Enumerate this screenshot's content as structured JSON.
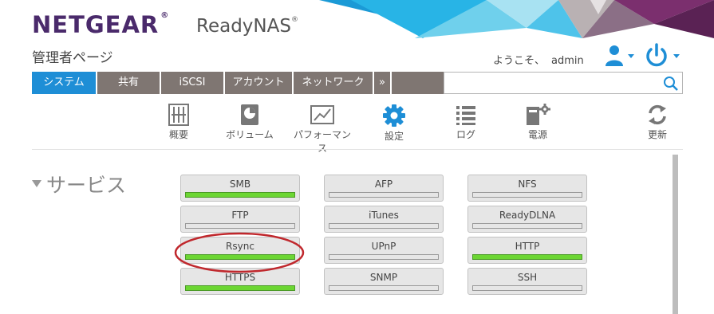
{
  "header": {
    "brand": "NETGEAR",
    "brand_mark": "®",
    "product": "ReadyNAS",
    "product_mark": "®",
    "page_title": "管理者ページ",
    "welcome_text": "ようこそ、",
    "username": "admin"
  },
  "nav": {
    "tabs": [
      {
        "label": "システム",
        "active": true
      },
      {
        "label": "共有",
        "active": false
      },
      {
        "label": "iSCSI",
        "active": false
      },
      {
        "label": "アカウント",
        "active": false
      },
      {
        "label": "ネットワーク",
        "active": false
      },
      {
        "label": "»",
        "active": false
      }
    ],
    "search_value": ""
  },
  "subnav": {
    "items": [
      {
        "label": "概要",
        "icon": "overview-icon"
      },
      {
        "label": "ボリューム",
        "icon": "volume-icon"
      },
      {
        "label": "パフォーマンス",
        "icon": "performance-icon"
      },
      {
        "label": "設定",
        "icon": "settings-gear-icon",
        "active": true
      },
      {
        "label": "ログ",
        "icon": "log-list-icon"
      },
      {
        "label": "電源",
        "icon": "power-device-icon"
      },
      {
        "label": "更新",
        "icon": "refresh-icon"
      }
    ]
  },
  "services": {
    "title": "サービス",
    "items": [
      {
        "label": "SMB",
        "enabled": true
      },
      {
        "label": "AFP",
        "enabled": false
      },
      {
        "label": "NFS",
        "enabled": false
      },
      {
        "label": "FTP",
        "enabled": false
      },
      {
        "label": "iTunes",
        "enabled": false
      },
      {
        "label": "ReadyDLNA",
        "enabled": false
      },
      {
        "label": "Rsync",
        "enabled": true
      },
      {
        "label": "UPnP",
        "enabled": false
      },
      {
        "label": "HTTP",
        "enabled": true
      },
      {
        "label": "HTTPS",
        "enabled": true
      },
      {
        "label": "SNMP",
        "enabled": false
      },
      {
        "label": "SSH",
        "enabled": false
      }
    ]
  },
  "colors": {
    "brand_purple": "#4a2a6b",
    "active_tab_blue": "#1e8ed6",
    "nav_gray": "#7f7672",
    "enabled_green": "#6cd633",
    "annotation_red": "#c0282d",
    "icon_blue": "#1e8ed6"
  }
}
